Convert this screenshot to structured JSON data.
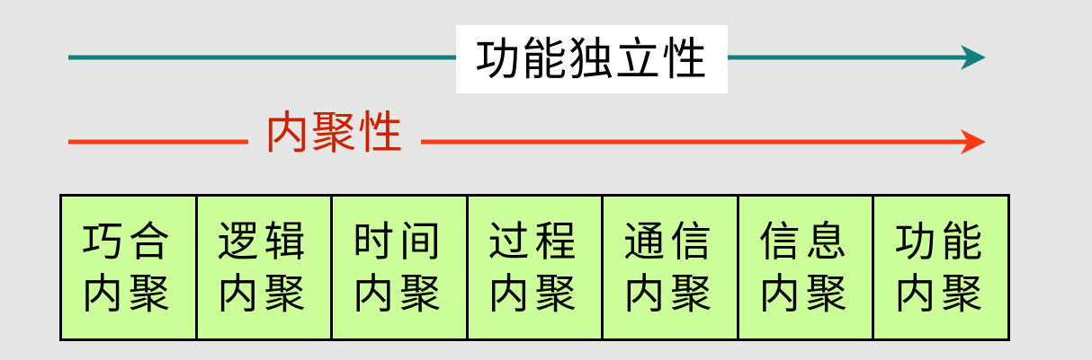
{
  "arrows": {
    "functional_independence": {
      "label": "功能独立性",
      "color": "#138080",
      "label_color": "#000000"
    },
    "cohesion": {
      "label": "内聚性",
      "color": "#ff3a10",
      "label_color": "#cc2200"
    }
  },
  "table": {
    "background": "#ccff99",
    "cells": [
      {
        "line1": "巧合",
        "line2": "内聚"
      },
      {
        "line1": "逻辑",
        "line2": "内聚"
      },
      {
        "line1": "时间",
        "line2": "内聚"
      },
      {
        "line1": "过程",
        "line2": "内聚"
      },
      {
        "line1": "通信",
        "line2": "内聚"
      },
      {
        "line1": "信息",
        "line2": "内聚"
      },
      {
        "line1": "功能",
        "line2": "内聚"
      }
    ]
  }
}
